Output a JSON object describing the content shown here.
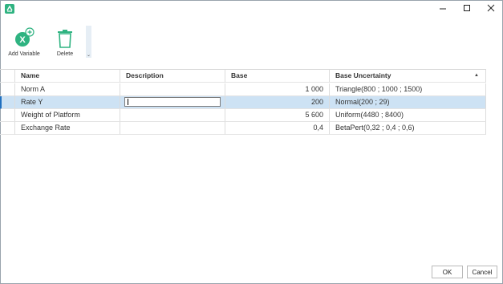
{
  "window": {
    "controls": [
      "minimize",
      "maximize",
      "close"
    ]
  },
  "ribbon": {
    "add_variable_label": "Add Variable",
    "delete_label": "Delete",
    "overflow_glyph": "⌄"
  },
  "grid": {
    "columns": [
      "",
      "Name",
      "Description",
      "Base",
      "Base Uncertainty"
    ],
    "sort_glyph": "▲",
    "rows": [
      {
        "name": "Norm A",
        "description": "",
        "base": "1 000",
        "uncertainty": "Triangle(800 ; 1000 ; 1500)"
      },
      {
        "name": "Rate Y",
        "description": "",
        "base": "200",
        "uncertainty": "Normal(200 ; 29)"
      },
      {
        "name": "Weight of Platform",
        "description": "",
        "base": "5 600",
        "uncertainty": "Uniform(4480 ; 8400)"
      },
      {
        "name": "Exchange Rate",
        "description": "",
        "base": "0,4",
        "uncertainty": "BetaPert(0,32 ; 0,4 ; 0,6)"
      }
    ]
  },
  "footer": {
    "ok_label": "OK",
    "cancel_label": "Cancel"
  },
  "colors": {
    "accent": "#2fb381",
    "selection": "#cde2f4"
  }
}
